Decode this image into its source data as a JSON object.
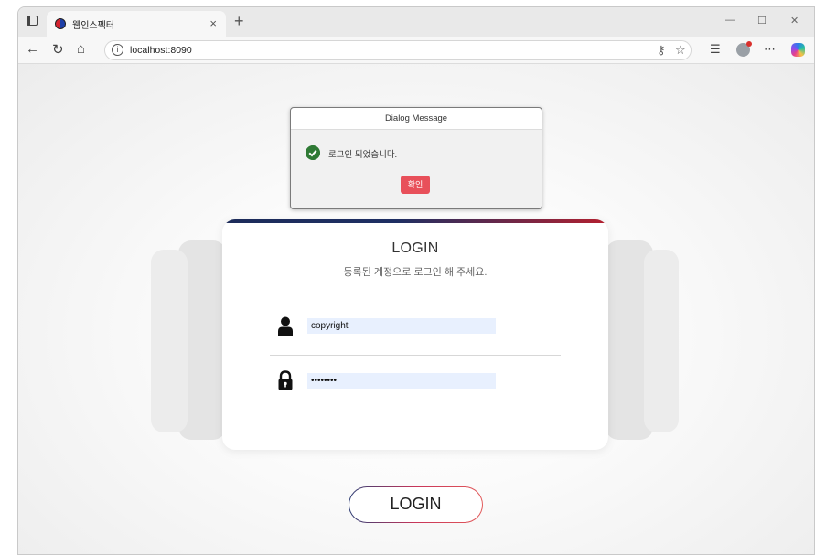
{
  "browser": {
    "tab_title": "웹인스펙터",
    "tab_close": "×",
    "new_tab": "+",
    "url": "localhost:8090",
    "controls": {
      "minimize": "—",
      "maximize": "☐",
      "close": "✕"
    }
  },
  "dialog": {
    "title": "Dialog Message",
    "message": "로그인 되었습니다.",
    "confirm_label": "확인"
  },
  "login_card": {
    "title": "LOGIN",
    "subtitle": "등록된 계정으로 로그인 해 주세요.",
    "username_value": "copyright",
    "password_value": "••••••••"
  },
  "login_button_label": "LOGIN",
  "icons": [
    "tab-actions-icon",
    "favicon-icon",
    "back-icon",
    "refresh-icon",
    "home-icon",
    "info-icon",
    "key-icon",
    "favorite-star-icon",
    "favorites-list-icon",
    "profile-icon",
    "more-icon",
    "copilot-icon",
    "user-icon",
    "lock-icon",
    "check-icon"
  ],
  "colors": {
    "accent_navy": "#1e2f63",
    "accent_red": "#b4202f",
    "dialog_button": "#e8505a",
    "success": "#2f7a35",
    "input_fill": "#e8f0fe"
  }
}
